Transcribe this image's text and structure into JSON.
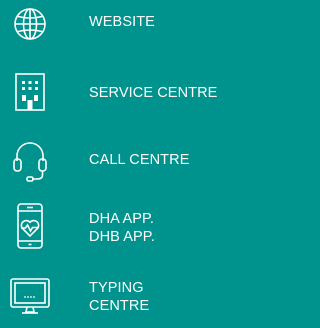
{
  "theme": {
    "background": "#00928d",
    "foreground": "#ffffff"
  },
  "channels": [
    {
      "id": "website",
      "icon": "globe-icon",
      "lines": [
        "WEBSITE"
      ]
    },
    {
      "id": "service-centre",
      "icon": "building-icon",
      "lines": [
        "SERVICE CENTRE"
      ]
    },
    {
      "id": "call-centre",
      "icon": "headset-icon",
      "lines": [
        "CALL CENTRE"
      ]
    },
    {
      "id": "app",
      "icon": "mobile-heart-icon",
      "lines": [
        "DHA APP.",
        "DHB APP."
      ]
    },
    {
      "id": "typing-centre",
      "icon": "monitor-icon",
      "lines": [
        "TYPING",
        "CENTRE"
      ]
    }
  ]
}
